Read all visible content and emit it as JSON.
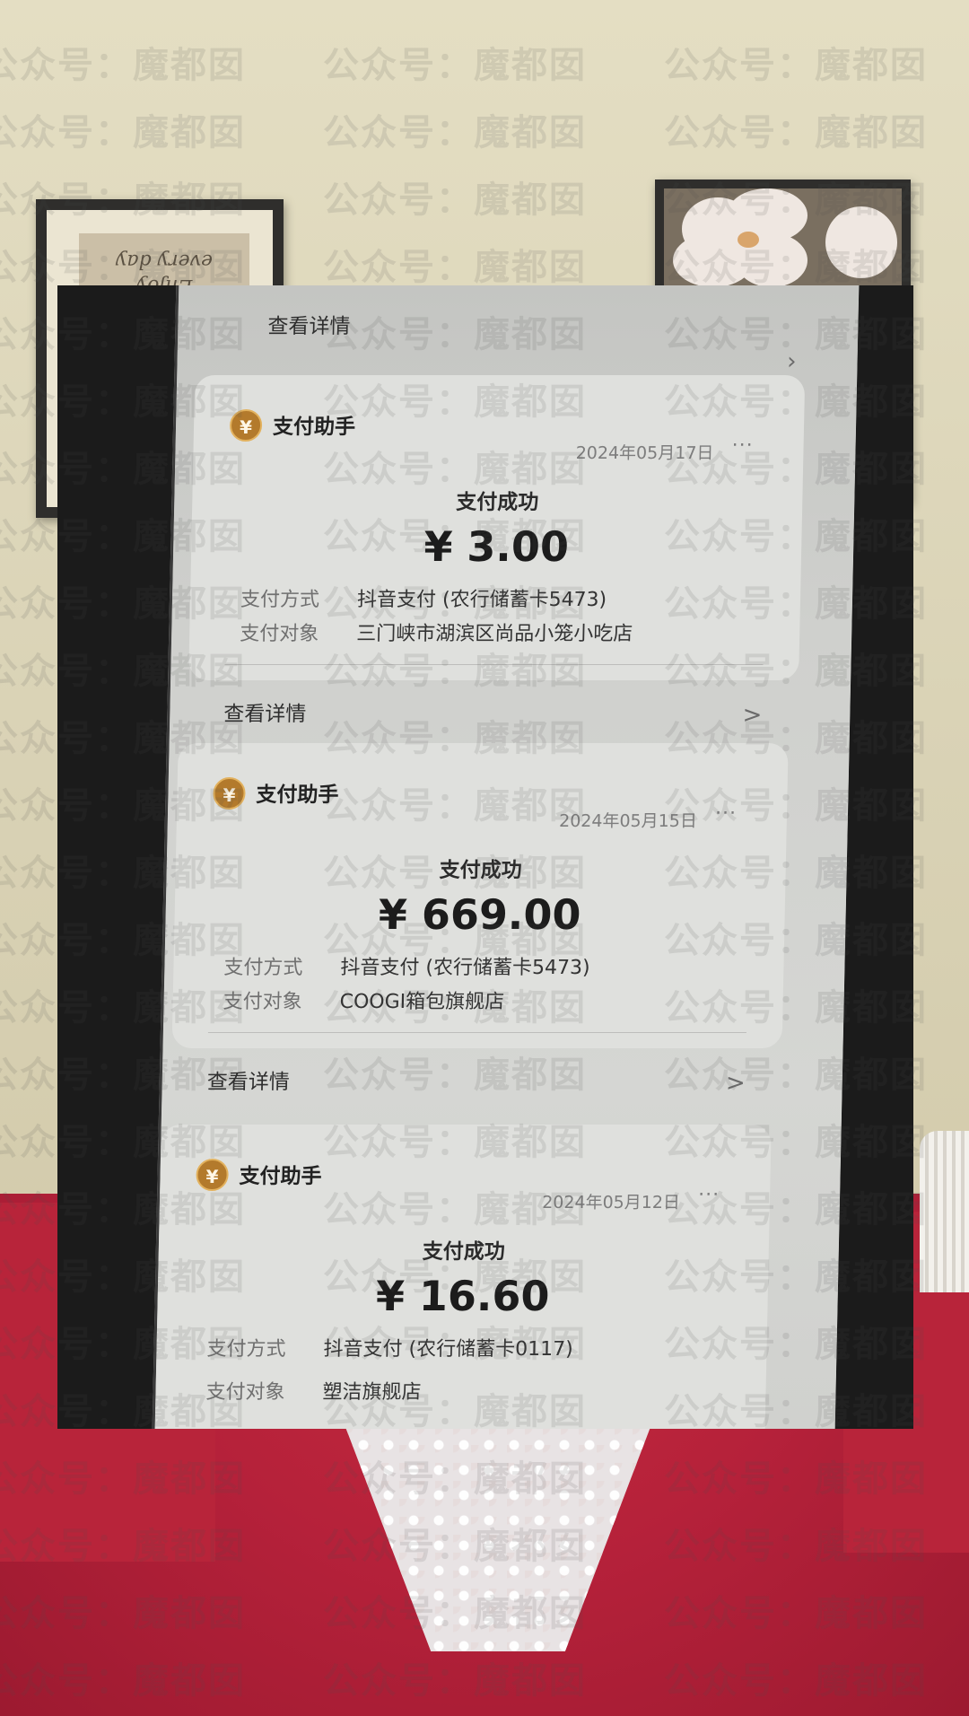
{
  "top_detail": {
    "label": "查看详情",
    "chevron": "chevron-right-icon"
  },
  "cards": [
    {
      "sender": "支付助手",
      "logo_glyph": "¥",
      "date": "2024年05月17日",
      "more": "···",
      "status": "支付成功",
      "amount": "¥ 3.00",
      "method_label": "支付方式",
      "method_value": "抖音支付 (农行储蓄卡5473)",
      "target_label": "支付对象",
      "target_value": "三门峡市湖滨区尚品小笼小吃店",
      "detail_label": "查看详情",
      "chevron": ">"
    },
    {
      "sender": "支付助手",
      "logo_glyph": "¥",
      "date": "2024年05月15日",
      "more": "···",
      "status": "支付成功",
      "amount": "¥ 669.00",
      "method_label": "支付方式",
      "method_value": "抖音支付 (农行储蓄卡5473)",
      "target_label": "支付对象",
      "target_value": "COOGI箱包旗舰店",
      "detail_label": "查看详情",
      "chevron": ">"
    },
    {
      "sender": "支付助手",
      "logo_glyph": "¥",
      "date": "2024年05月12日",
      "more": "···",
      "status": "支付成功",
      "amount": "¥ 16.60",
      "method_label": "支付方式",
      "method_value": "抖音支付 (农行储蓄卡0117)",
      "target_label": "支付对象",
      "target_value": "塑洁旗舰店"
    }
  ],
  "background": {
    "poster_text_line1": "Enjoy",
    "poster_text_line2": "every day"
  },
  "watermark": {
    "text": "公众号：魔都囡"
  },
  "colors": {
    "logo_gold": "#b37a2c",
    "shirt_red": "#b8243a",
    "card_bg": "#dfe0dd"
  }
}
